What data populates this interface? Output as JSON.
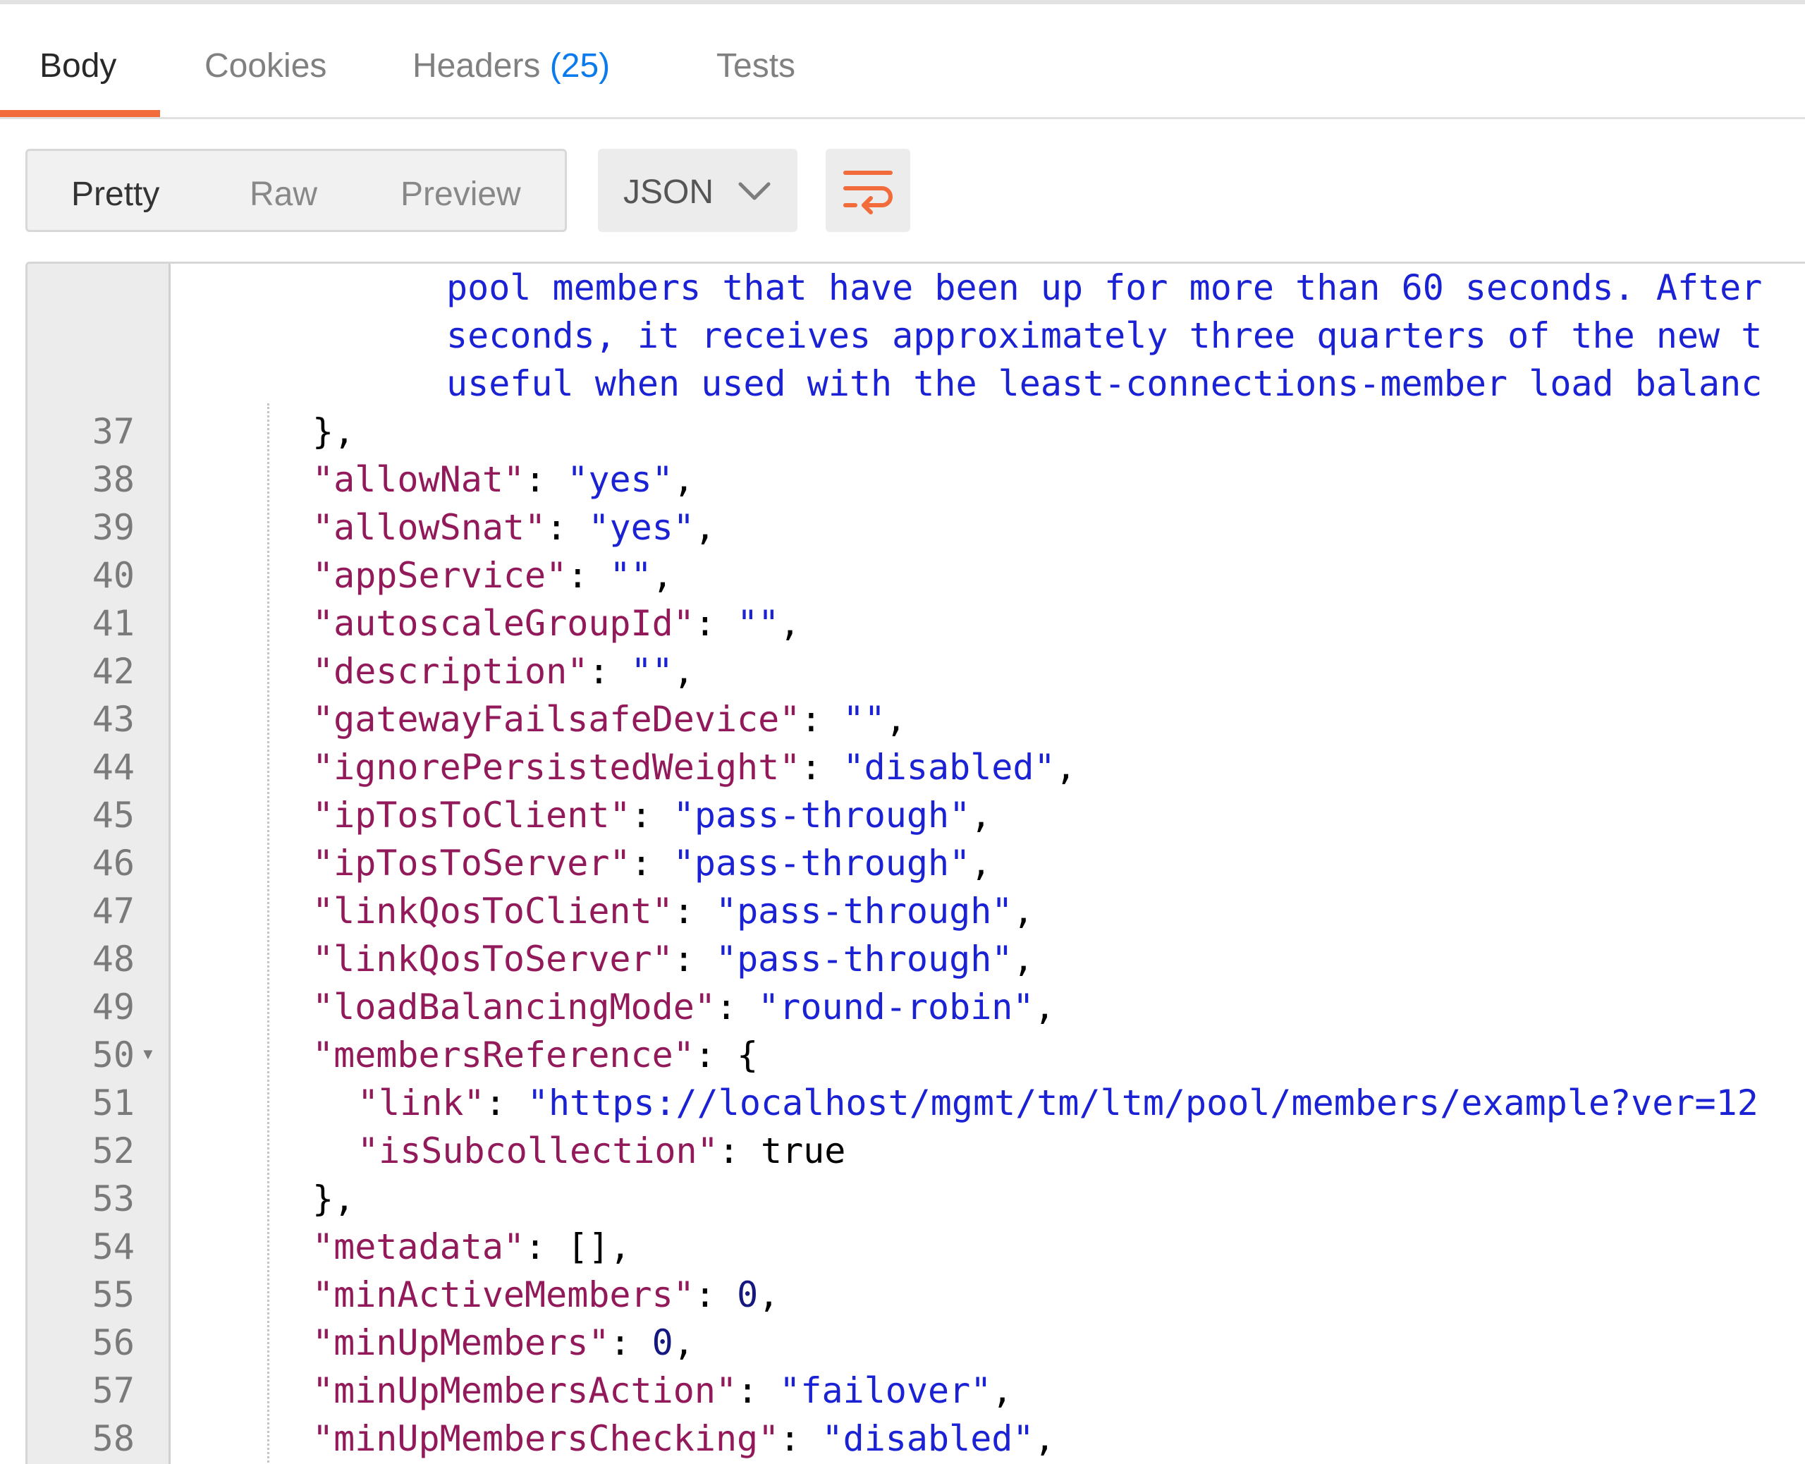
{
  "tabs": [
    {
      "label": "Body",
      "count": ""
    },
    {
      "label": "Cookies",
      "count": ""
    },
    {
      "label": "Headers",
      "count": "(25)"
    },
    {
      "label": "Tests",
      "count": ""
    }
  ],
  "active_tab": "Body",
  "view_modes": [
    "Pretty",
    "Raw",
    "Preview"
  ],
  "active_view_mode": "Pretty",
  "format": {
    "selected": "JSON",
    "icon": "chevron-down-icon"
  },
  "wrap_button": {
    "icon": "wrap-lines-icon"
  },
  "colors": {
    "accent": "#f26b3a",
    "count_blue": "#097bed",
    "json_key": "#92195a",
    "json_string": "#1b22d4",
    "json_number": "#15187f"
  },
  "editor": {
    "wrapped_text": [
      "pool members that have been up for more than 60 seconds. After",
      "seconds, it receives approximately three quarters of the new t",
      "useful when used with the least-connections-member load balanc"
    ],
    "lines": [
      {
        "num": "37",
        "brace": "},"
      },
      {
        "num": "38",
        "key": "\"allowNat\"",
        "sep": ": ",
        "value": "\"yes\"",
        "end": ","
      },
      {
        "num": "39",
        "key": "\"allowSnat\"",
        "sep": ": ",
        "value": "\"yes\"",
        "end": ","
      },
      {
        "num": "40",
        "key": "\"appService\"",
        "sep": ": ",
        "value": "\"\"",
        "end": ","
      },
      {
        "num": "41",
        "key": "\"autoscaleGroupId\"",
        "sep": ": ",
        "value": "\"\"",
        "end": ","
      },
      {
        "num": "42",
        "key": "\"description\"",
        "sep": ": ",
        "value": "\"\"",
        "end": ","
      },
      {
        "num": "43",
        "key": "\"gatewayFailsafeDevice\"",
        "sep": ": ",
        "value": "\"\"",
        "end": ","
      },
      {
        "num": "44",
        "key": "\"ignorePersistedWeight\"",
        "sep": ": ",
        "value": "\"disabled\"",
        "end": ","
      },
      {
        "num": "45",
        "key": "\"ipTosToClient\"",
        "sep": ": ",
        "value": "\"pass-through\"",
        "end": ","
      },
      {
        "num": "46",
        "key": "\"ipTosToServer\"",
        "sep": ": ",
        "value": "\"pass-through\"",
        "end": ","
      },
      {
        "num": "47",
        "key": "\"linkQosToClient\"",
        "sep": ": ",
        "value": "\"pass-through\"",
        "end": ","
      },
      {
        "num": "48",
        "key": "\"linkQosToServer\"",
        "sep": ": ",
        "value": "\"pass-through\"",
        "end": ","
      },
      {
        "num": "49",
        "key": "\"loadBalancingMode\"",
        "sep": ": ",
        "value": "\"round-robin\"",
        "end": ","
      },
      {
        "num": "50",
        "key": "\"membersReference\"",
        "sep": ": ",
        "brace_open": "{"
      },
      {
        "num": "51",
        "key": "\"link\"",
        "sep": ": ",
        "value": "\"https://localhost/mgmt/tm/ltm/pool/members/example?ver=12",
        "end": ""
      },
      {
        "num": "52",
        "key": "\"isSubcollection\"",
        "sep": ": ",
        "literal": "true",
        "end": ""
      },
      {
        "num": "53",
        "brace": "},"
      },
      {
        "num": "54",
        "key": "\"metadata\"",
        "sep": ": ",
        "literal": "[]",
        "end": ","
      },
      {
        "num": "55",
        "key": "\"minActiveMembers\"",
        "sep": ": ",
        "number": "0",
        "end": ","
      },
      {
        "num": "56",
        "key": "\"minUpMembers\"",
        "sep": ": ",
        "number": "0",
        "end": ","
      },
      {
        "num": "57",
        "key": "\"minUpMembersAction\"",
        "sep": ": ",
        "value": "\"failover\"",
        "end": ","
      },
      {
        "num": "58",
        "key": "\"minUpMembersChecking\"",
        "sep": ": ",
        "value": "\"disabled\"",
        "end": ","
      }
    ]
  }
}
